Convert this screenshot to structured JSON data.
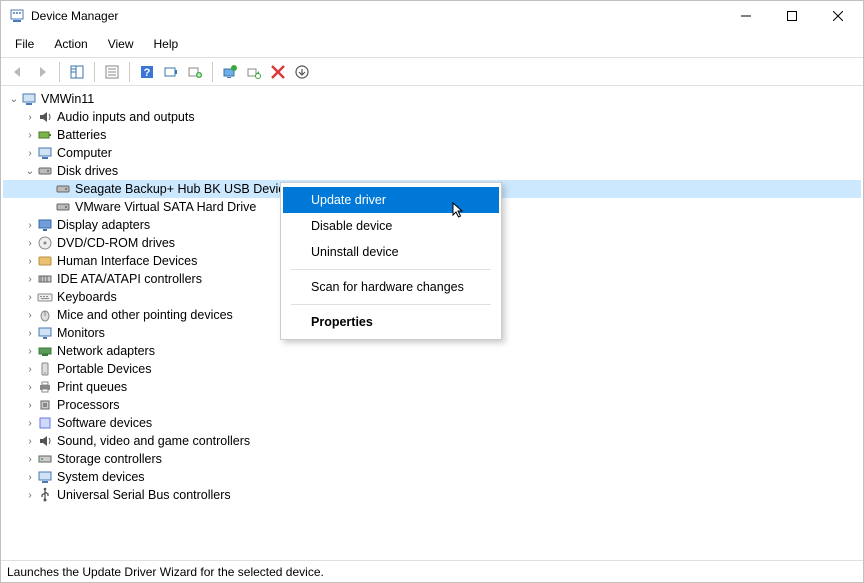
{
  "window": {
    "title": "Device Manager"
  },
  "menu": {
    "file": "File",
    "action": "Action",
    "view": "View",
    "help": "Help"
  },
  "tree": {
    "root": "VMWin11",
    "audio": "Audio inputs and outputs",
    "batteries": "Batteries",
    "computer": "Computer",
    "diskdrives": "Disk drives",
    "seagate": "Seagate Backup+ Hub BK USB Device",
    "vmware": "VMware Virtual SATA Hard Drive",
    "display": "Display adapters",
    "dvd": "DVD/CD-ROM drives",
    "hid": "Human Interface Devices",
    "ide": "IDE ATA/ATAPI controllers",
    "keyboards": "Keyboards",
    "mice": "Mice and other pointing devices",
    "monitors": "Monitors",
    "network": "Network adapters",
    "portable": "Portable Devices",
    "printq": "Print queues",
    "proc": "Processors",
    "software": "Software devices",
    "sound": "Sound, video and game controllers",
    "storage": "Storage controllers",
    "system": "System devices",
    "usb": "Universal Serial Bus controllers"
  },
  "context": {
    "update": "Update driver",
    "disable": "Disable device",
    "uninstall": "Uninstall device",
    "scan": "Scan for hardware changes",
    "props": "Properties"
  },
  "status": "Launches the Update Driver Wizard for the selected device."
}
